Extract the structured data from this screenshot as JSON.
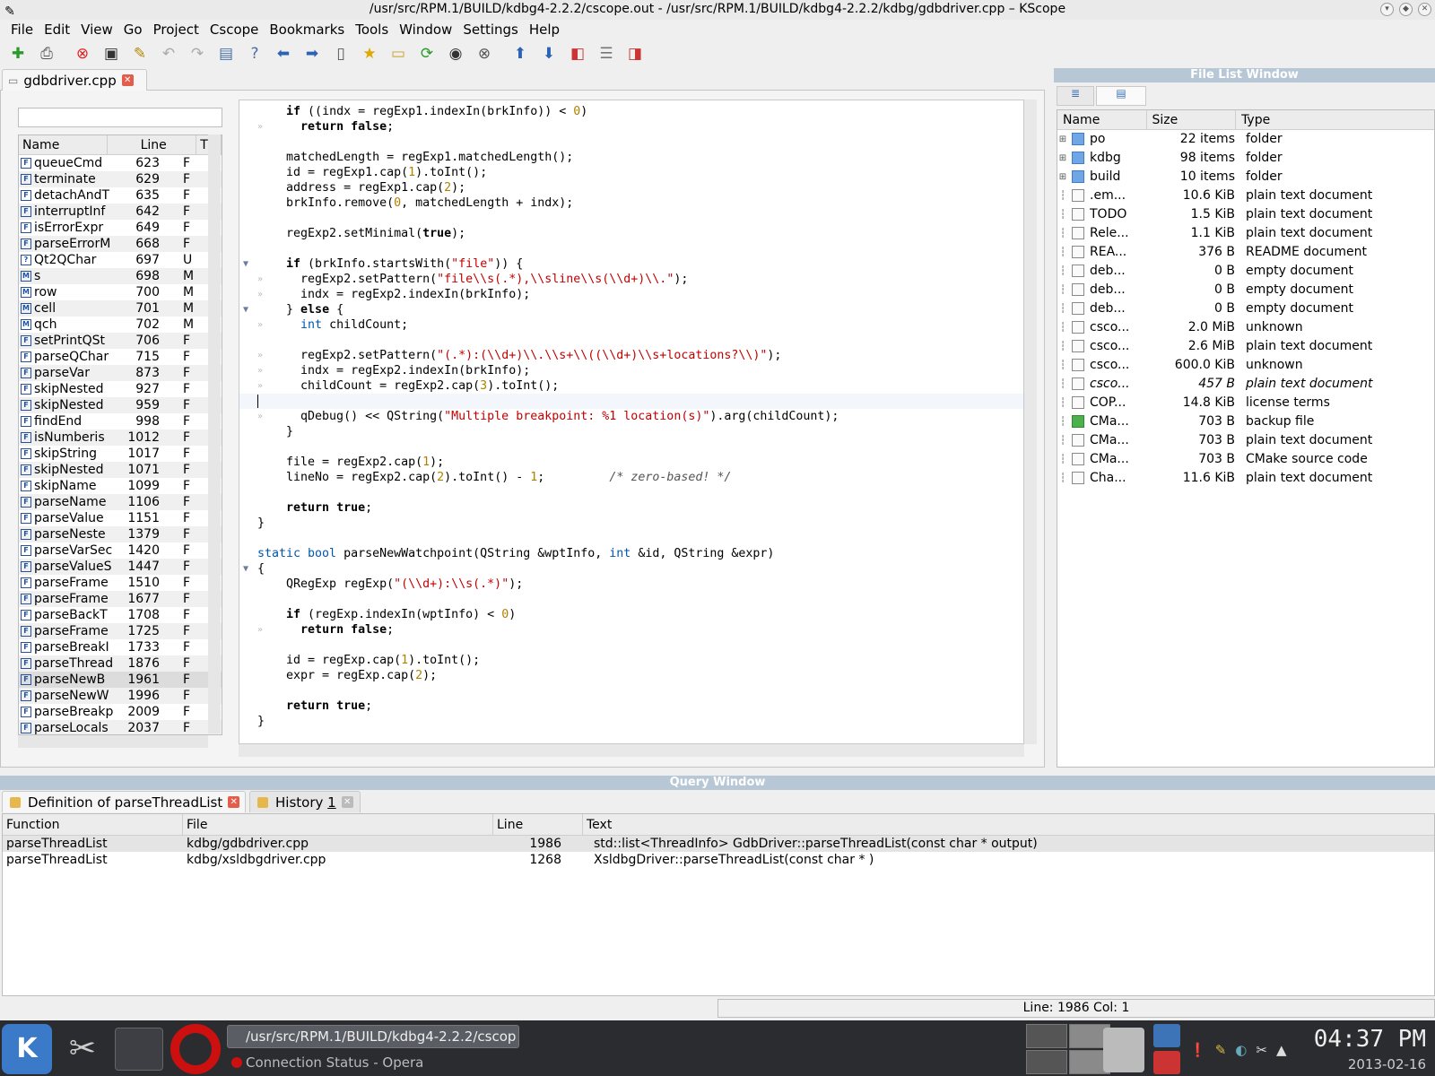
{
  "window": {
    "title": "/usr/src/RPM.1/BUILD/kdbg4-2.2.2/cscope.out - /usr/src/RPM.1/BUILD/kdbg4-2.2.2/kdbg/gdbdriver.cpp – KScope"
  },
  "menu": [
    "File",
    "Edit",
    "View",
    "Go",
    "Project",
    "Cscope",
    "Bookmarks",
    "Tools",
    "Window",
    "Settings",
    "Help"
  ],
  "editor_tab": {
    "label": "gdbdriver.cpp"
  },
  "symbols": {
    "headers": {
      "name": "Name",
      "line": "Line",
      "type": "T"
    },
    "rows": [
      {
        "icon": "F",
        "name": "queueCmd",
        "line": "623",
        "type": "F"
      },
      {
        "icon": "F",
        "name": "terminate",
        "line": "629",
        "type": "F"
      },
      {
        "icon": "F",
        "name": "detachAndT",
        "line": "635",
        "type": "F"
      },
      {
        "icon": "F",
        "name": "interruptInf",
        "line": "642",
        "type": "F"
      },
      {
        "icon": "F",
        "name": "isErrorExpr",
        "line": "649",
        "type": "F"
      },
      {
        "icon": "F",
        "name": "parseErrorM",
        "line": "668",
        "type": "F"
      },
      {
        "icon": "?",
        "name": "Qt2QChar",
        "line": "697",
        "type": "U"
      },
      {
        "icon": "M",
        "name": "s",
        "line": "698",
        "type": "M"
      },
      {
        "icon": "M",
        "name": "row",
        "line": "700",
        "type": "M"
      },
      {
        "icon": "M",
        "name": "cell",
        "line": "701",
        "type": "M"
      },
      {
        "icon": "M",
        "name": "qch",
        "line": "702",
        "type": "M"
      },
      {
        "icon": "F",
        "name": "setPrintQSt",
        "line": "706",
        "type": "F"
      },
      {
        "icon": "F",
        "name": "parseQChar",
        "line": "715",
        "type": "F"
      },
      {
        "icon": "F",
        "name": "parseVar",
        "line": "873",
        "type": "F"
      },
      {
        "icon": "F",
        "name": "skipNested",
        "line": "927",
        "type": "F"
      },
      {
        "icon": "F",
        "name": "skipNested",
        "line": "959",
        "type": "F"
      },
      {
        "icon": "F",
        "name": "findEnd",
        "line": "998",
        "type": "F"
      },
      {
        "icon": "F",
        "name": "isNumberis",
        "line": "1012",
        "type": "F"
      },
      {
        "icon": "F",
        "name": "skipString",
        "line": "1017",
        "type": "F"
      },
      {
        "icon": "F",
        "name": "skipNested",
        "line": "1071",
        "type": "F"
      },
      {
        "icon": "F",
        "name": "skipName",
        "line": "1099",
        "type": "F"
      },
      {
        "icon": "F",
        "name": "parseName",
        "line": "1106",
        "type": "F"
      },
      {
        "icon": "F",
        "name": "parseValue",
        "line": "1151",
        "type": "F"
      },
      {
        "icon": "F",
        "name": "parseNeste",
        "line": "1379",
        "type": "F"
      },
      {
        "icon": "F",
        "name": "parseVarSec",
        "line": "1420",
        "type": "F"
      },
      {
        "icon": "F",
        "name": "parseValueS",
        "line": "1447",
        "type": "F"
      },
      {
        "icon": "F",
        "name": "parseFrame",
        "line": "1510",
        "type": "F"
      },
      {
        "icon": "F",
        "name": "parseFrame",
        "line": "1677",
        "type": "F"
      },
      {
        "icon": "F",
        "name": "parseBackT",
        "line": "1708",
        "type": "F"
      },
      {
        "icon": "F",
        "name": "parseFrame",
        "line": "1725",
        "type": "F"
      },
      {
        "icon": "F",
        "name": "parseBreakI",
        "line": "1733",
        "type": "F"
      },
      {
        "icon": "F",
        "name": "parseThread",
        "line": "1876",
        "type": "F"
      },
      {
        "icon": "F",
        "name": "parseNewB",
        "line": "1961",
        "type": "F"
      },
      {
        "icon": "F",
        "name": "parseNewW",
        "line": "1996",
        "type": "F"
      },
      {
        "icon": "F",
        "name": "parseBreakp",
        "line": "2009",
        "type": "F"
      },
      {
        "icon": "F",
        "name": "parseLocals",
        "line": "2037",
        "type": "F"
      }
    ]
  },
  "file_list": {
    "title": "File List Window",
    "headers": {
      "name": "Name",
      "size": "Size",
      "type": "Type"
    },
    "rows": [
      {
        "kind": "folder",
        "name": "po",
        "size": "22 items",
        "type": "folder"
      },
      {
        "kind": "folder",
        "name": "kdbg",
        "size": "98 items",
        "type": "folder"
      },
      {
        "kind": "folder",
        "name": "build",
        "size": "10 items",
        "type": "folder"
      },
      {
        "kind": "doc",
        "name": ".em...",
        "size": "10.6 KiB",
        "type": "plain text document"
      },
      {
        "kind": "doc",
        "name": "TODO",
        "size": "1.5 KiB",
        "type": "plain text document"
      },
      {
        "kind": "doc",
        "name": "Rele...",
        "size": "1.1 KiB",
        "type": "plain text document"
      },
      {
        "kind": "doc",
        "name": "REA...",
        "size": "376 B",
        "type": "README document"
      },
      {
        "kind": "doc",
        "name": "deb...",
        "size": "0 B",
        "type": "empty document"
      },
      {
        "kind": "doc",
        "name": "deb...",
        "size": "0 B",
        "type": "empty document"
      },
      {
        "kind": "doc",
        "name": "deb...",
        "size": "0 B",
        "type": "empty document"
      },
      {
        "kind": "doc",
        "name": "csco...",
        "size": "2.0 MiB",
        "type": "unknown"
      },
      {
        "kind": "doc",
        "name": "csco...",
        "size": "2.6 MiB",
        "type": "plain text document"
      },
      {
        "kind": "doc",
        "name": "csco...",
        "size": "600.0 KiB",
        "type": "unknown"
      },
      {
        "kind": "doc",
        "name": "csco...",
        "size": "457 B",
        "type": "plain text document",
        "italic": true
      },
      {
        "kind": "doc",
        "name": "COP...",
        "size": "14.8 KiB",
        "type": "license terms"
      },
      {
        "kind": "backup",
        "name": "CMa...",
        "size": "703 B",
        "type": "backup file"
      },
      {
        "kind": "doc",
        "name": "CMa...",
        "size": "703 B",
        "type": "plain text document"
      },
      {
        "kind": "doc",
        "name": "CMa...",
        "size": "703 B",
        "type": "CMake source code"
      },
      {
        "kind": "doc",
        "name": "Cha...",
        "size": "11.6 KiB",
        "type": "plain text document"
      }
    ]
  },
  "code_lines": [
    {
      "html": "    <span class='kw'>if</span> ((indx = regExp1.indexIn(brkInfo)) &lt; <span class='nm'>0</span>)"
    },
    {
      "html": "      <span class='kw'>return false</span>;",
      "dot": true
    },
    {
      "html": ""
    },
    {
      "html": "    matchedLength = regExp1.matchedLength();"
    },
    {
      "html": "    id = regExp1.cap(<span class='nm'>1</span>).toInt();"
    },
    {
      "html": "    address = regExp1.cap(<span class='nm'>2</span>);"
    },
    {
      "html": "    brkInfo.remove(<span class='nm'>0</span>, matchedLength + indx);"
    },
    {
      "html": ""
    },
    {
      "html": "    regExp2.setMinimal(<span class='kw'>true</span>);"
    },
    {
      "html": ""
    },
    {
      "html": "    <span class='kw'>if</span> (brkInfo.startsWith(<span class='st'>\"file\"</span>)) {",
      "fold": true
    },
    {
      "html": "      regExp2.setPattern(<span class='st'>\"file\\\\s(.*),\\\\sline\\\\s(\\\\d+)\\\\.\"</span>);",
      "dot": true
    },
    {
      "html": "      indx = regExp2.indexIn(brkInfo);",
      "dot": true
    },
    {
      "html": "    } <span class='kw'>else</span> {",
      "fold": true
    },
    {
      "html": "      <span class='ty'>int</span> childCount;",
      "dot": true
    },
    {
      "html": ""
    },
    {
      "html": "      regExp2.setPattern(<span class='st'>\"(.*):(\\\\d+)\\\\.\\\\s+\\\\((\\\\d+)\\\\s+locations?\\\\)\"</span>);",
      "dot": true
    },
    {
      "html": "      indx = regExp2.indexIn(brkInfo);",
      "dot": true
    },
    {
      "html": "      childCount = regExp2.cap(<span class='nm'>3</span>).toInt();",
      "dot": true
    },
    {
      "html": "",
      "cur": true
    },
    {
      "html": "      qDebug() &lt;&lt; QString(<span class='st'>\"Multiple breakpoint: %1 location(s)\"</span>).arg(childCount);",
      "dot": true
    },
    {
      "html": "    }"
    },
    {
      "html": ""
    },
    {
      "html": "    file = regExp2.cap(<span class='nm'>1</span>);"
    },
    {
      "html": "    lineNo = regExp2.cap(<span class='nm'>2</span>).toInt() - <span class='nm'>1</span>;         <span class='cm'>/* zero-based! */</span>"
    },
    {
      "html": ""
    },
    {
      "html": "    <span class='kw'>return true</span>;"
    },
    {
      "html": "}"
    },
    {
      "html": ""
    },
    {
      "html": "<span class='ty'>static bool</span> parseNewWatchpoint(QString &amp;wptInfo, <span class='ty'>int</span> &amp;id, QString &amp;expr)"
    },
    {
      "html": "{",
      "fold": true
    },
    {
      "html": "    QRegExp regExp(<span class='st'>\"(\\\\d+):\\\\s(.*)\"</span>);"
    },
    {
      "html": ""
    },
    {
      "html": "    <span class='kw'>if</span> (regExp.indexIn(wptInfo) &lt; <span class='nm'>0</span>)"
    },
    {
      "html": "      <span class='kw'>return false</span>;",
      "dot": true
    },
    {
      "html": ""
    },
    {
      "html": "    id = regExp.cap(<span class='nm'>1</span>).toInt();"
    },
    {
      "html": "    expr = regExp.cap(<span class='nm'>2</span>);"
    },
    {
      "html": ""
    },
    {
      "html": "    <span class='kw'>return true</span>;"
    },
    {
      "html": "}"
    }
  ],
  "query_window": {
    "title": "Query Window",
    "tab1": "Definition of parseThreadList",
    "tab2": "History",
    "tab2_num": "1",
    "headers": {
      "function": "Function",
      "file": "File",
      "line": "Line",
      "text": "Text"
    },
    "rows": [
      {
        "function": "parseThreadList",
        "file": "kdbg/gdbdriver.cpp",
        "line": "1986",
        "text": "std::list<ThreadInfo> GdbDriver::parseThreadList(const char * output)"
      },
      {
        "function": "parseThreadList",
        "file": "kdbg/xsldbgdriver.cpp",
        "line": "1268",
        "text": "XsldbgDriver::parseThreadList(const char * )"
      }
    ]
  },
  "status": {
    "position": "Line: 1986 Col: 1"
  },
  "taskbar": {
    "task1": "/usr/src/RPM.1/BUILD/kdbg4-2.2.2/cscop",
    "task2": "Connection Status - Opera",
    "time": "04:37 PM",
    "date": "2013-02-16"
  },
  "colors": {
    "accent": "#0057ae",
    "string": "#bf0303",
    "number": "#b08000",
    "close": "#e45c4a"
  }
}
